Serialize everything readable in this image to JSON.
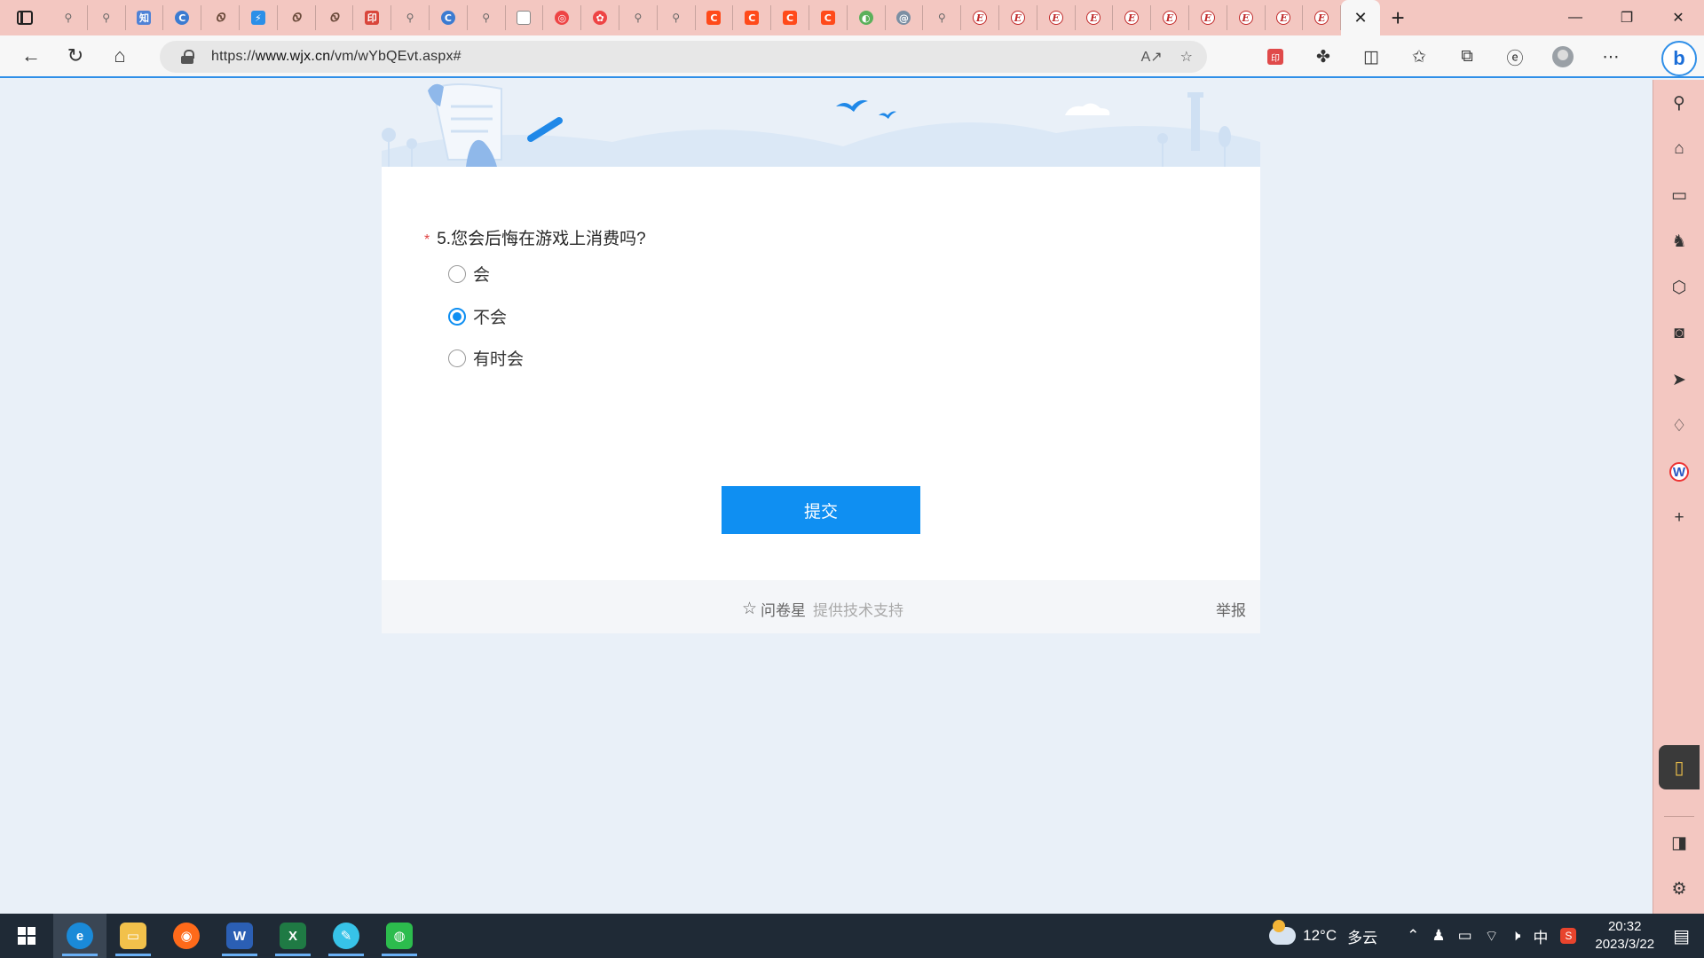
{
  "browser": {
    "tab_favicons": [
      "search",
      "search",
      "zhi",
      "swirl",
      "calli",
      "bolt",
      "calli",
      "calli",
      "red-seal",
      "search",
      "swirl",
      "search",
      "doc",
      "red-circle",
      "flower",
      "search",
      "search",
      "orange-c",
      "orange-c",
      "orange-c",
      "orange-c",
      "green-leaf",
      "spiral",
      "search",
      "e-italic",
      "e-italic",
      "e-italic",
      "e-italic",
      "e-italic",
      "e-italic",
      "e-italic",
      "e-italic",
      "e-italic",
      "e-italic",
      "e-italic",
      "e-italic"
    ],
    "active_tab_close": "✕",
    "new_tab": "+",
    "url_prefix": "https://",
    "url_host": "www.wjx.cn",
    "url_path": "/vm/wYbQEvt.aspx#",
    "bing_label": "b"
  },
  "survey": {
    "required_mark": "*",
    "question": "5.您会后悔在游戏上消费吗?",
    "options": [
      {
        "label": "会",
        "selected": false
      },
      {
        "label": "不会",
        "selected": true
      },
      {
        "label": "有时会",
        "selected": false
      }
    ],
    "submit_label": "提交",
    "footer_brand": "问卷星",
    "footer_support": "提供技术支持",
    "footer_report": "举报"
  },
  "taskbar": {
    "weather_temp": "12°C",
    "weather_desc": "多云",
    "ime": "中",
    "time": "20:32",
    "date": "2023/3/22"
  },
  "colors": {
    "accent": "#0f8ff2",
    "tabstrip": "#f3c7c1",
    "page_bg": "#e9f0f8",
    "required": "#e04444"
  }
}
